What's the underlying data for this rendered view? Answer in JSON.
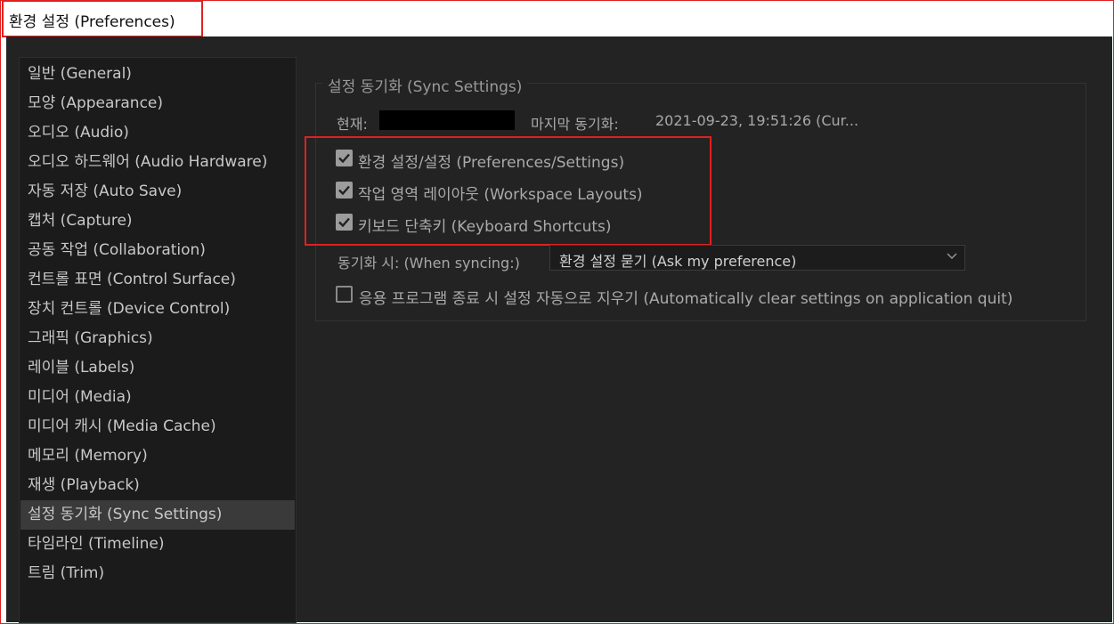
{
  "window": {
    "title": "환경 설정 (Preferences)"
  },
  "sidebar": {
    "items": [
      {
        "label": "일반 (General)"
      },
      {
        "label": "모양 (Appearance)"
      },
      {
        "label": "오디오 (Audio)"
      },
      {
        "label": "오디오 하드웨어 (Audio Hardware)"
      },
      {
        "label": "자동 저장 (Auto Save)"
      },
      {
        "label": "캡처 (Capture)"
      },
      {
        "label": "공동 작업 (Collaboration)"
      },
      {
        "label": "컨트롤 표면 (Control Surface)"
      },
      {
        "label": "장치 컨트롤 (Device Control)"
      },
      {
        "label": "그래픽 (Graphics)"
      },
      {
        "label": "레이블 (Labels)"
      },
      {
        "label": "미디어 (Media)"
      },
      {
        "label": "미디어 캐시 (Media Cache)"
      },
      {
        "label": "메모리 (Memory)"
      },
      {
        "label": "재생 (Playback)"
      },
      {
        "label": "설정 동기화 (Sync Settings)",
        "selected": true
      },
      {
        "label": "타임라인 (Timeline)"
      },
      {
        "label": "트림 (Trim)"
      }
    ]
  },
  "sync": {
    "group_title": "설정 동기화 (Sync Settings)",
    "current_label": "현재:",
    "last_sync_label": "마지막 동기화:",
    "last_sync_value": "2021-09-23, 19:51:26 (Cur...",
    "checkboxes": [
      {
        "label": "환경 설정/설정 (Preferences/Settings)",
        "checked": true
      },
      {
        "label": "작업 영역 레이아웃 (Workspace Layouts)",
        "checked": true
      },
      {
        "label": "키보드 단축키 (Keyboard Shortcuts)",
        "checked": true
      }
    ],
    "when_syncing_label": "동기화 시: (When syncing:)",
    "when_syncing_value": "환경 설정 묻기 (Ask my preference)",
    "auto_clear": {
      "label": "응용 프로그램 종료 시 설정 자동으로 지우기 (Automatically clear settings on application quit)",
      "checked": false
    }
  },
  "colors": {
    "highlight": "#e02020",
    "panel_bg": "#232323",
    "sidebar_bg": "#1b1b1b",
    "selected_bg": "#3a3a3a"
  }
}
